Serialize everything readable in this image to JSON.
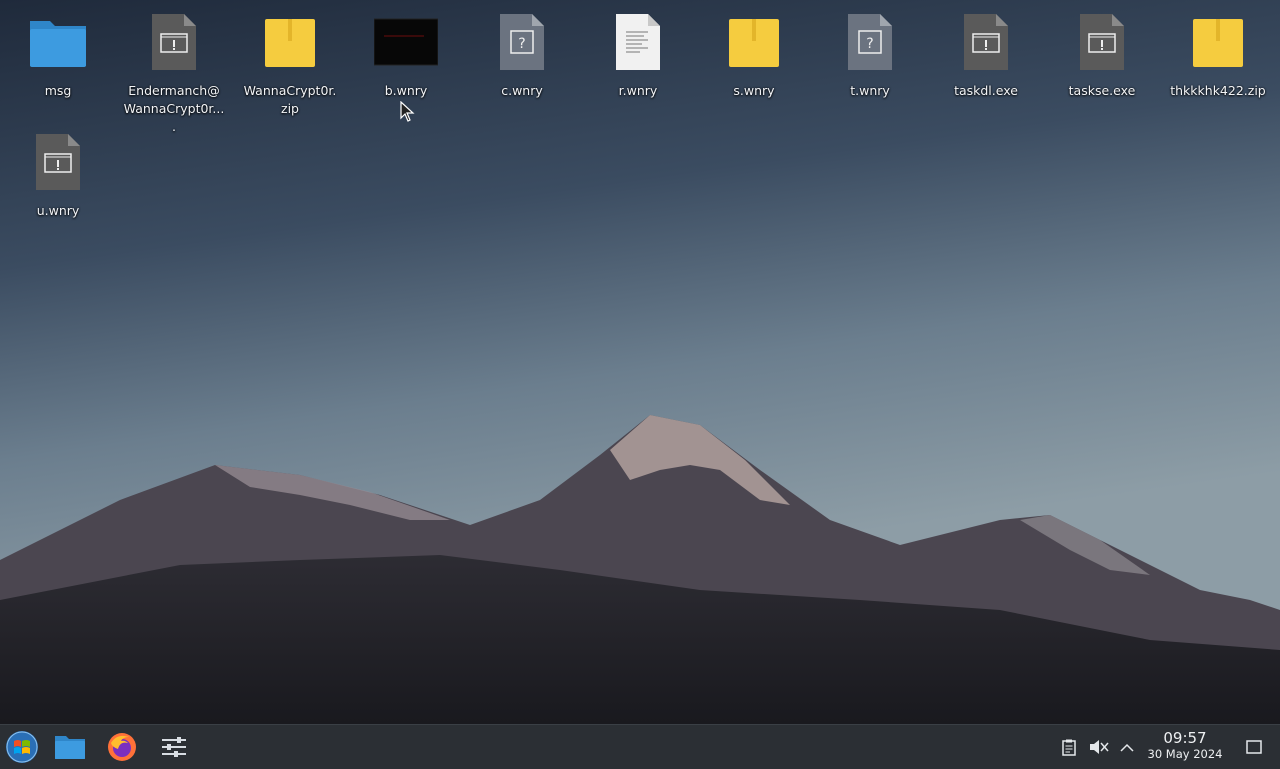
{
  "desktop": {
    "icons": [
      {
        "label": "msg",
        "icon": "folder-icon"
      },
      {
        "label": "Endermanch@\nWannaCrypt0r....",
        "icon": "executable-icon"
      },
      {
        "label": "WannaCrypt0r.\nzip",
        "icon": "zip-archive-icon"
      },
      {
        "label": "b.wnry",
        "icon": "image-thumbnail-icon"
      },
      {
        "label": "c.wnry",
        "icon": "unknown-file-icon"
      },
      {
        "label": "r.wnry",
        "icon": "text-document-icon"
      },
      {
        "label": "s.wnry",
        "icon": "zip-archive-icon"
      },
      {
        "label": "t.wnry",
        "icon": "unknown-file-icon"
      },
      {
        "label": "taskdl.exe",
        "icon": "executable-icon"
      },
      {
        "label": "taskse.exe",
        "icon": "executable-icon"
      },
      {
        "label": "thkkkhk422.zip",
        "icon": "zip-archive-icon"
      },
      {
        "label": "u.wnry",
        "icon": "executable-icon"
      }
    ]
  },
  "taskbar": {
    "launchers": [
      "start-menu-icon",
      "file-manager-icon",
      "firefox-icon",
      "settings-icon"
    ],
    "tray": [
      "clipboard-icon",
      "volume-muted-icon",
      "chevron-up-icon"
    ],
    "clock": {
      "time": "09:57",
      "date": "30 May 2024"
    }
  },
  "colors": {
    "folder": "#3d9be0",
    "zip": "#f5cc3f",
    "executable": "#5a5a5a",
    "taskbar": "#2b2f34"
  }
}
